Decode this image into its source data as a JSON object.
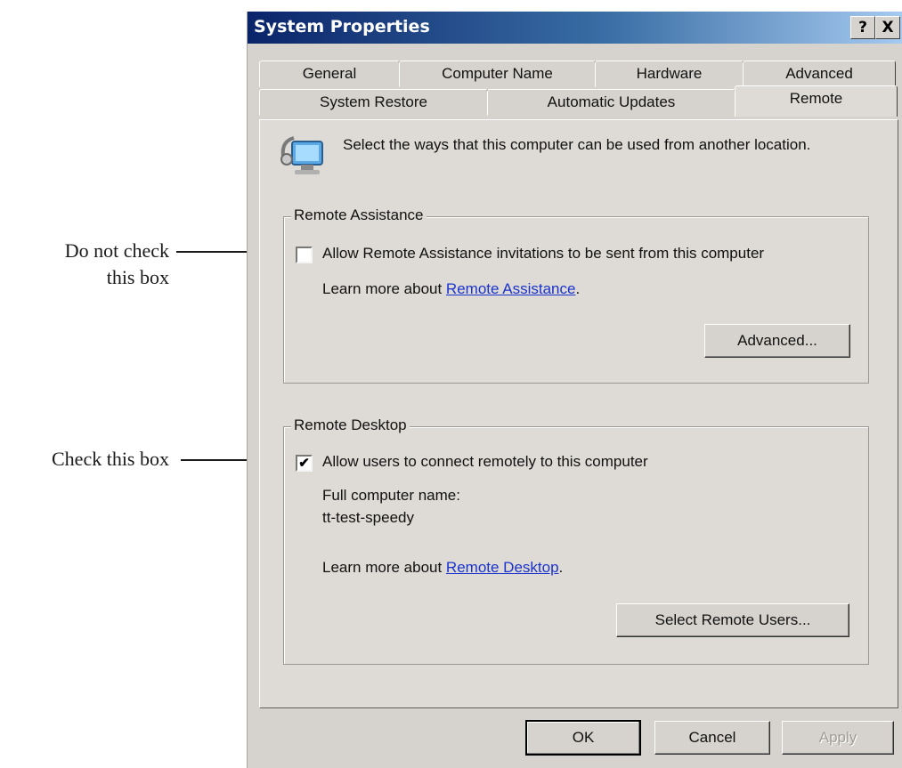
{
  "annotations": {
    "remote_assistance_note": [
      "Do not check",
      "this box"
    ],
    "remote_desktop_note": "Check this box"
  },
  "window": {
    "title": "System Properties",
    "help_glyph": "?",
    "close_glyph": "X"
  },
  "tabs": {
    "row1": [
      "General",
      "Computer Name",
      "Hardware",
      "Advanced"
    ],
    "row2": [
      "System Restore",
      "Automatic Updates",
      "Remote"
    ],
    "active": "Remote"
  },
  "intro": {
    "icon": "remote-computer-icon",
    "text": "Select the ways that this computer can be used from another location."
  },
  "remote_assistance": {
    "legend": "Remote Assistance",
    "checkbox_label": "Allow Remote Assistance invitations to be sent from this computer",
    "checked": false,
    "learn_prefix": "Learn more about ",
    "learn_link": "Remote Assistance",
    "learn_suffix": ".",
    "advanced_button": "Advanced..."
  },
  "remote_desktop": {
    "legend": "Remote Desktop",
    "checkbox_label": "Allow users to connect remotely to this computer",
    "checked": true,
    "check_glyph": "✔",
    "computer_name_label": "Full computer name:",
    "computer_name": "tt-test-speedy",
    "learn_prefix": "Learn more about ",
    "learn_link": "Remote Desktop",
    "learn_suffix": ".",
    "select_users_button": "Select Remote Users..."
  },
  "footer": {
    "ok": "OK",
    "cancel": "Cancel",
    "apply": "Apply",
    "apply_enabled": false
  }
}
